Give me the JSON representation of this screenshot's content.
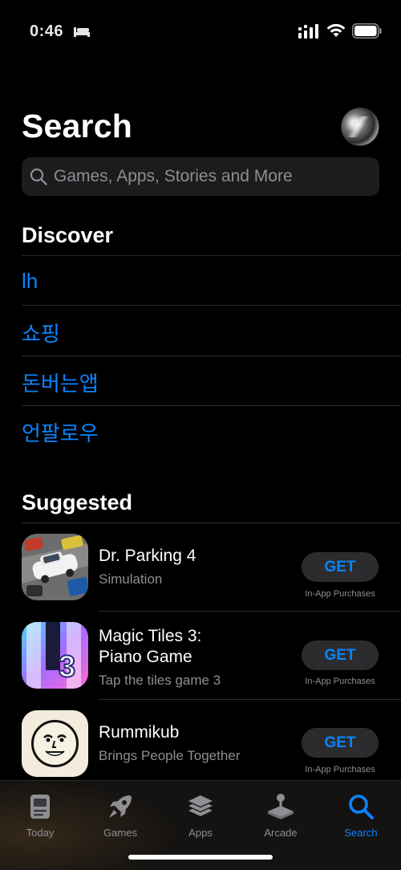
{
  "status_bar": {
    "time": "0:46"
  },
  "header": {
    "title": "Search"
  },
  "search": {
    "placeholder": "Games, Apps, Stories and More"
  },
  "discover": {
    "title": "Discover",
    "items": [
      {
        "label": "lh"
      },
      {
        "label": "쇼핑"
      },
      {
        "label": "돈버는앱"
      },
      {
        "label": "언팔로우"
      }
    ]
  },
  "suggested": {
    "title": "Suggested",
    "apps": [
      {
        "name_line1": "Dr. Parking 4",
        "name_line2": "",
        "subtitle": "Simulation",
        "button": "GET",
        "note": "In-App Purchases"
      },
      {
        "name_line1": "Magic Tiles 3:",
        "name_line2": "Piano Game",
        "subtitle": "Tap the tiles game 3",
        "button": "GET",
        "note": "In-App Purchases"
      },
      {
        "name_line1": "Rummikub",
        "name_line2": "",
        "subtitle": "Brings People Together",
        "button": "GET",
        "note": "In-App Purchases"
      }
    ]
  },
  "tabs": [
    {
      "label": "Today",
      "icon": "today-icon"
    },
    {
      "label": "Games",
      "icon": "rocket-icon"
    },
    {
      "label": "Apps",
      "icon": "layers-icon"
    },
    {
      "label": "Arcade",
      "icon": "joystick-icon"
    },
    {
      "label": "Search",
      "icon": "search-icon",
      "active": true
    }
  ],
  "colors": {
    "accent": "#0a84ff",
    "background": "#000000",
    "secondary_text": "#8e8e93"
  }
}
